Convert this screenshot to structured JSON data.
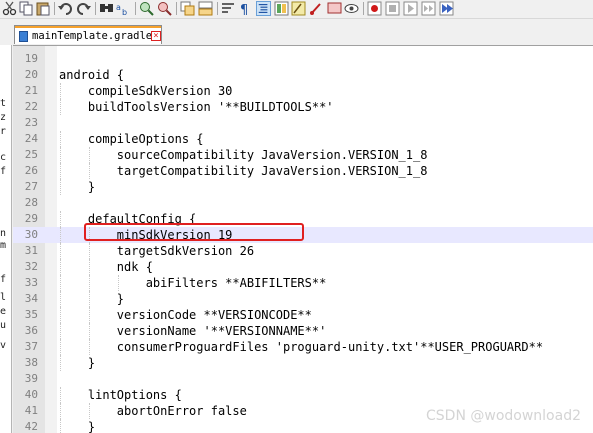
{
  "toolbar": {
    "icons": [
      "cut-icon",
      "copy-icon",
      "paste-icon",
      "undo-icon",
      "redo-icon",
      "find-icon",
      "replace-icon",
      "zoom-in-icon",
      "zoom-out-icon",
      "sync-vertical-icon",
      "sync-horizontal-icon",
      "word-wrap-icon",
      "show-all-chars-icon",
      "indent-guide-icon",
      "doc-map-icon",
      "function-list-icon",
      "folder-workspace-icon",
      "monitor-icon",
      "record-macro-icon",
      "stop-macro-icon",
      "play-macro-icon",
      "run-macro-multiple-icon",
      "save-macro-icon"
    ]
  },
  "tab": {
    "filename": "mainTemplate.gradle"
  },
  "side_fragments": [
    "t",
    "z",
    "r",
    "c",
    "f",
    "n",
    "m",
    "f",
    "l",
    "e",
    "u",
    "v"
  ],
  "editor": {
    "lines": [
      {
        "num": "19",
        "text": ""
      },
      {
        "num": "20",
        "text": "android {"
      },
      {
        "num": "21",
        "text": "    compileSdkVersion 30"
      },
      {
        "num": "22",
        "text": "    buildToolsVersion '**BUILDTOOLS**'"
      },
      {
        "num": "23",
        "text": ""
      },
      {
        "num": "24",
        "text": "    compileOptions {"
      },
      {
        "num": "25",
        "text": "        sourceCompatibility JavaVersion.VERSION_1_8"
      },
      {
        "num": "26",
        "text": "        targetCompatibility JavaVersion.VERSION_1_8"
      },
      {
        "num": "27",
        "text": "    }"
      },
      {
        "num": "28",
        "text": ""
      },
      {
        "num": "29",
        "text": "    defaultConfig {"
      },
      {
        "num": "30",
        "text": "        minSdkVersion 19"
      },
      {
        "num": "31",
        "text": "        targetSdkVersion 26"
      },
      {
        "num": "32",
        "text": "        ndk {"
      },
      {
        "num": "33",
        "text": "            abiFilters **ABIFILTERS**"
      },
      {
        "num": "34",
        "text": "        }"
      },
      {
        "num": "35",
        "text": "        versionCode **VERSIONCODE**"
      },
      {
        "num": "36",
        "text": "        versionName '**VERSIONNAME**'"
      },
      {
        "num": "37",
        "text": "        consumerProguardFiles 'proguard-unity.txt'**USER_PROGUARD**"
      },
      {
        "num": "38",
        "text": "    }"
      },
      {
        "num": "39",
        "text": ""
      },
      {
        "num": "40",
        "text": "    lintOptions {"
      },
      {
        "num": "41",
        "text": "        abortOnError false"
      },
      {
        "num": "42",
        "text": "    }"
      }
    ],
    "current_line": "30"
  },
  "watermark": "CSDN @wodownload2",
  "colors": {
    "highlight_box": "#e02020",
    "current_line_bg": "#e8e8ff",
    "tab_accent": "#f6a12b"
  }
}
